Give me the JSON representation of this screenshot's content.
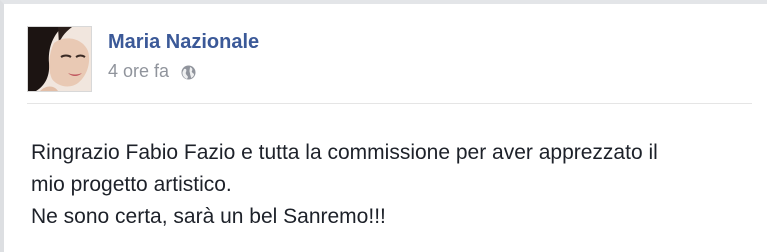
{
  "post": {
    "author": "Maria Nazionale",
    "timestamp": "4 ore fa",
    "privacy_icon": "globe-icon",
    "lines": [
      "Ringrazio Fabio Fazio e tutta la commissione per aver apprezzato il",
      "mio progetto artistico.",
      "Ne sono certa, sarà un bel Sanremo!!!"
    ]
  },
  "colors": {
    "author_link": "#3b5998",
    "meta_text": "#90949c",
    "body_text": "#1d2129"
  }
}
